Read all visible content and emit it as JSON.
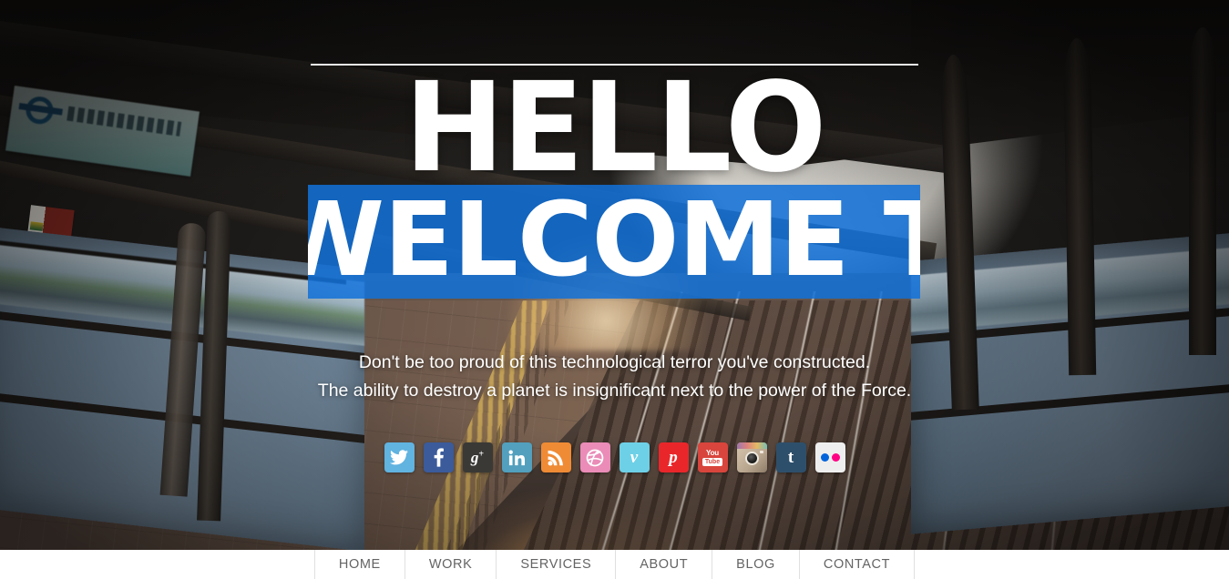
{
  "hero": {
    "heading_line1": "HELLO",
    "heading_line2": "WELCOME TO SCRN",
    "subtitle_line1": "Don't be too proud of this technological terror you've constructed.",
    "subtitle_line2": "The ability to destroy a planet is insignificant next to the power of the Force.",
    "accent_color": "#1271d8",
    "background_scene": "train-station-platform-at-sunset"
  },
  "social": {
    "items": [
      {
        "name": "twitter",
        "icon": "twitter-icon",
        "label": "Twitter",
        "color": "#61b3e0"
      },
      {
        "name": "facebook",
        "icon": "facebook-icon",
        "label": "Facebook",
        "color": "#3b5b9b"
      },
      {
        "name": "googleplus",
        "icon": "google-plus-icon",
        "label": "Google+",
        "color": "#3a3936"
      },
      {
        "name": "linkedin",
        "icon": "linkedin-icon",
        "label": "LinkedIn",
        "color": "#52a0bd"
      },
      {
        "name": "rss",
        "icon": "rss-icon",
        "label": "RSS",
        "color": "#ef8b35"
      },
      {
        "name": "dribbble",
        "icon": "dribbble-icon",
        "label": "Dribbble",
        "color": "#ea8cb7"
      },
      {
        "name": "vimeo",
        "icon": "vimeo-icon",
        "label": "Vimeo",
        "color": "#6ed0e6"
      },
      {
        "name": "pinterest",
        "icon": "pinterest-icon",
        "label": "Pinterest",
        "color": "#e9272b"
      },
      {
        "name": "youtube",
        "icon": "youtube-icon",
        "label": "YouTube",
        "color": "#d8453c"
      },
      {
        "name": "instagram",
        "icon": "instagram-icon",
        "label": "Instagram",
        "color": "#cbbba6"
      },
      {
        "name": "tumblr",
        "icon": "tumblr-icon",
        "label": "Tumblr",
        "color": "#2e4f6b"
      },
      {
        "name": "flickr",
        "icon": "flickr-icon",
        "label": "Flickr",
        "color": "#eeeeee"
      }
    ]
  },
  "nav": {
    "items": [
      {
        "label": "HOME"
      },
      {
        "label": "WORK"
      },
      {
        "label": "SERVICES"
      },
      {
        "label": "ABOUT"
      },
      {
        "label": "BLOG"
      },
      {
        "label": "CONTACT"
      }
    ]
  }
}
